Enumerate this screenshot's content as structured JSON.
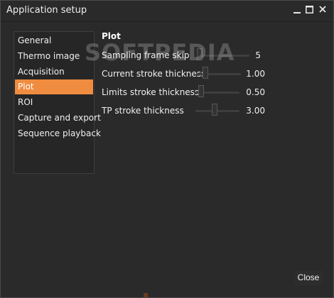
{
  "window": {
    "title": "Application setup",
    "controls": {
      "minimize_icon": "minimize-icon",
      "maximize_icon": "maximize-icon",
      "close_icon": "close-icon"
    }
  },
  "nav": {
    "items": [
      {
        "label": "General"
      },
      {
        "label": "Thermo image"
      },
      {
        "label": "Acquisition"
      },
      {
        "label": "Plot",
        "active": true
      },
      {
        "label": "ROI"
      },
      {
        "label": "Capture and export"
      },
      {
        "label": "Sequence playback"
      }
    ]
  },
  "panel": {
    "title": "Plot",
    "settings": [
      {
        "label": "Sampling frame skip",
        "value": "5",
        "level": 0.0
      },
      {
        "label": "Current stroke thickness",
        "value": "1.00",
        "level": 0.14
      },
      {
        "label": "Limits stroke thickness",
        "value": "0.50",
        "level": 0.07
      },
      {
        "label": "TP stroke thickness",
        "value": "3.00",
        "level": 0.43
      }
    ]
  },
  "watermark": "SOFTPEDIA",
  "footer": {
    "close_label": "Close"
  },
  "colors": {
    "accent": "#f08c3f",
    "background": "#2a2a2a",
    "text": "#f0f0f0"
  }
}
